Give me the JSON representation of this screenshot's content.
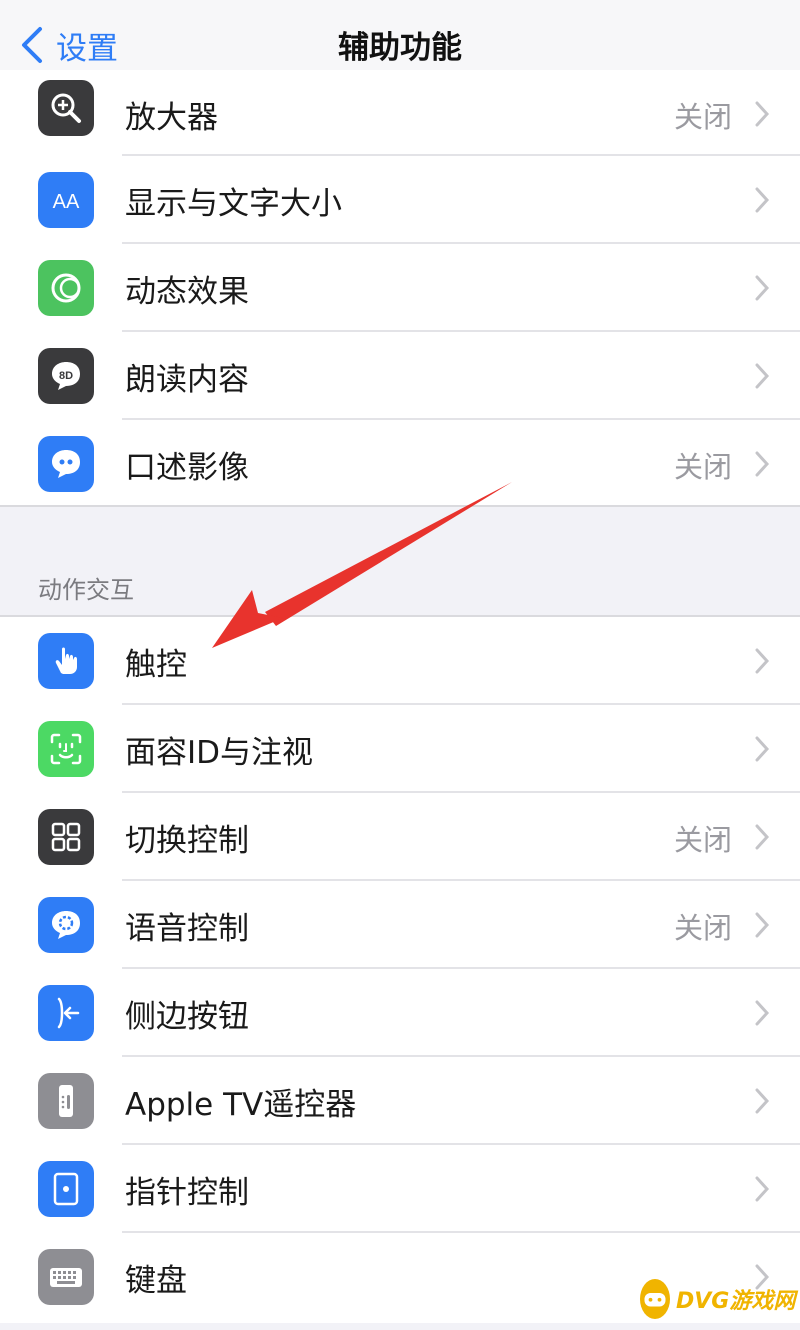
{
  "navbar": {
    "back_label": "设置",
    "title": "辅助功能"
  },
  "vision_items": [
    {
      "label": "放大器",
      "value": "关闭",
      "icon": "magnifier-icon",
      "color": "#3a3a3c"
    },
    {
      "label": "显示与文字大小",
      "value": "",
      "icon": "text-size-icon",
      "color": "#2f7df6"
    },
    {
      "label": "动态效果",
      "value": "",
      "icon": "motion-icon",
      "color": "#4cc35f"
    },
    {
      "label": "朗读内容",
      "value": "",
      "icon": "speech-bubble-icon",
      "color": "#3a3a3c"
    },
    {
      "label": "口述影像",
      "value": "关闭",
      "icon": "audio-description-icon",
      "color": "#2f7df6"
    }
  ],
  "section": {
    "header": "动作交互"
  },
  "interaction_items": [
    {
      "label": "触控",
      "value": "",
      "icon": "hand-touch-icon",
      "color": "#2f7df6"
    },
    {
      "label": "面容ID与注视",
      "value": "",
      "icon": "face-id-icon",
      "color": "#4cd964"
    },
    {
      "label": "切换控制",
      "value": "关闭",
      "icon": "switch-control-icon",
      "color": "#3a3a3c"
    },
    {
      "label": "语音控制",
      "value": "关闭",
      "icon": "voice-control-icon",
      "color": "#2f7df6"
    },
    {
      "label": "侧边按钮",
      "value": "",
      "icon": "side-button-icon",
      "color": "#2f7df6"
    },
    {
      "label": "Apple TV遥控器",
      "value": "",
      "icon": "tv-remote-icon",
      "color": "#8e8e93"
    },
    {
      "label": "指针控制",
      "value": "",
      "icon": "pointer-control-icon",
      "color": "#2f7df6"
    },
    {
      "label": "键盘",
      "value": "",
      "icon": "keyboard-icon",
      "color": "#8e8e93"
    }
  ],
  "watermark": {
    "text": "DVG游戏网"
  },
  "colors": {
    "accent": "#2f7df6",
    "arrow": "#e8332d",
    "watermark": "#f0b400"
  }
}
